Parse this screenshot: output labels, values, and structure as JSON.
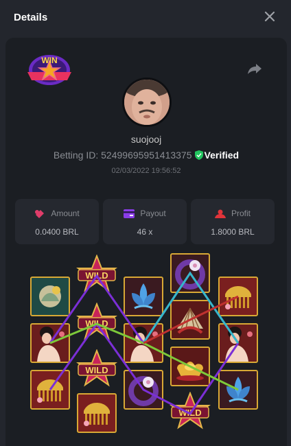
{
  "header": {
    "title": "Details"
  },
  "badge": {
    "text": "WIN"
  },
  "user": {
    "name": "suojooj",
    "betting_label": "Betting ID:",
    "betting_id": "52499695951413375",
    "verified_label": "Verified",
    "timestamp": "02/03/2022 19:56:52"
  },
  "stats": [
    {
      "label": "Amount",
      "value": "0.0400 BRL",
      "icon": "money-icon"
    },
    {
      "label": "Payout",
      "value": "46 x",
      "icon": "wallet-icon"
    },
    {
      "label": "Profit",
      "value": "1.8000 BRL",
      "icon": "profit-icon"
    }
  ],
  "reels": {
    "wild_text": "WILD",
    "columns": [
      [
        "lotus-pendant",
        "lady",
        "golden-comb"
      ],
      [
        "wild",
        "wild",
        "wild",
        "golden-comb"
      ],
      [
        "blue-lotus",
        "lady",
        "purple-pendant"
      ],
      [
        "purple-pendant",
        "red-fan",
        "gold-ingot",
        "wild"
      ],
      [
        "golden-comb",
        "lady",
        "blue-lotus"
      ]
    ]
  },
  "colors": {
    "background": "#23262d",
    "panel": "#1b1e23",
    "card": "#25282f",
    "verified": "#22c55e",
    "tile_border": "#d9a935",
    "payline_purple": "#7b2fd6",
    "payline_green": "#7dc93a",
    "payline_teal": "#35b8c9",
    "payline_red": "#c0312f"
  }
}
